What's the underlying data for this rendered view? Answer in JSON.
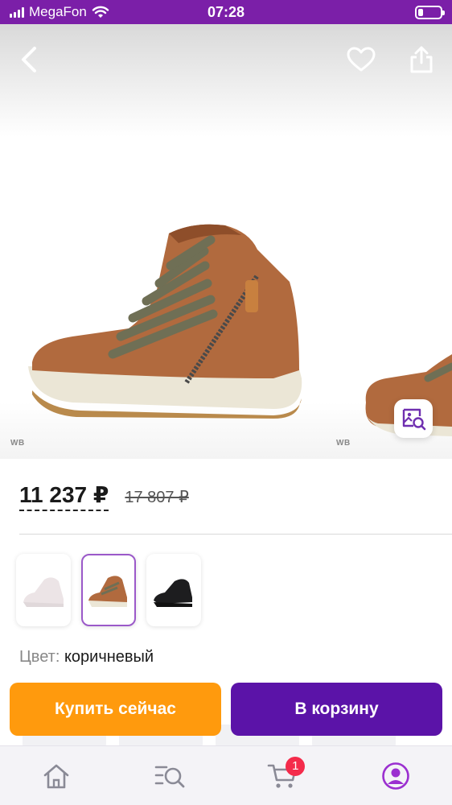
{
  "status_bar": {
    "carrier": "MegaFon",
    "time": "07:28"
  },
  "gallery": {
    "watermark_left": "WB",
    "watermark_right": "WB",
    "icons": {
      "back": "chevron-left-icon",
      "favorite": "heart-icon",
      "share": "share-icon",
      "zoom": "image-search-icon"
    }
  },
  "price": {
    "current": "11 237 ₽",
    "old": "17 807 ₽"
  },
  "color_variants": [
    {
      "name": "white",
      "selected": false
    },
    {
      "name": "brown",
      "selected": true
    },
    {
      "name": "black",
      "selected": false
    }
  ],
  "color": {
    "label": "Цвет:",
    "value": "коричневый"
  },
  "actions": {
    "buy_now": "Купить сейчас",
    "add_to_cart": "В корзину"
  },
  "bottom_nav": {
    "cart_badge": "1",
    "items": [
      "home-icon",
      "catalog-search-icon",
      "cart-icon",
      "profile-icon"
    ]
  },
  "colors": {
    "status_bar": "#7b1fa8",
    "buy_button": "#ff9a0d",
    "cart_button": "#5b13a8",
    "badge": "#f42b4b",
    "accent": "#9b59c9"
  }
}
